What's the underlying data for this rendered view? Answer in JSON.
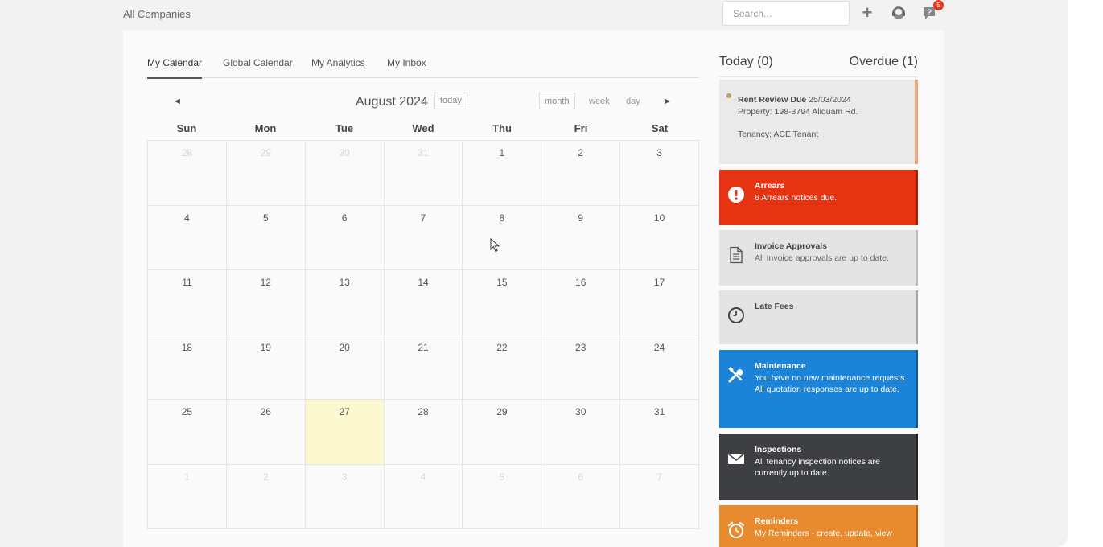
{
  "header": {
    "company": "All Companies",
    "search_placeholder": "Search...",
    "notification_count": "5"
  },
  "tabs": [
    {
      "label": "My Calendar",
      "active": true
    },
    {
      "label": "Global Calendar",
      "active": false
    },
    {
      "label": "My Analytics",
      "active": false
    },
    {
      "label": "My Inbox",
      "active": false
    }
  ],
  "calendar": {
    "prev_arrow": "◄",
    "next_arrow": "►",
    "month_title": "August 2024",
    "today_button": "today",
    "views": [
      "month",
      "week",
      "day"
    ],
    "days_of_week": [
      "Sun",
      "Mon",
      "Tue",
      "Wed",
      "Thu",
      "Fri",
      "Sat"
    ],
    "weeks": [
      [
        "28",
        "29",
        "30",
        "31",
        "1",
        "2",
        "3"
      ],
      [
        "4",
        "5",
        "6",
        "7",
        "8",
        "9",
        "10"
      ],
      [
        "11",
        "12",
        "13",
        "14",
        "15",
        "16",
        "17"
      ],
      [
        "18",
        "19",
        "20",
        "21",
        "22",
        "23",
        "24"
      ],
      [
        "25",
        "26",
        "27",
        "28",
        "29",
        "30",
        "31"
      ],
      [
        "1",
        "2",
        "3",
        "4",
        "5",
        "6",
        "7"
      ]
    ]
  },
  "summary": {
    "today": "Today (0)",
    "overdue": "Overdue (1)"
  },
  "rent_review": {
    "title": "Rent Review Due",
    "date": "25/03/2024",
    "property": "Property: 198-3794 Aliquam Rd.",
    "tenancy": "Tenancy: ACE Tenant"
  },
  "cards": {
    "arrears": {
      "title": "Arrears",
      "lines": [
        "6 Arrears notices due."
      ]
    },
    "invoice": {
      "title": "Invoice Approvals",
      "lines": [
        "All Invoice approvals are up to date."
      ]
    },
    "late_fees": {
      "title": "Late Fees",
      "lines": []
    },
    "maintenance": {
      "title": "Maintenance",
      "lines": [
        "You have no new maintenance requests.",
        "All quotation responses are up to date."
      ]
    },
    "inspections": {
      "title": "Inspections",
      "lines": [
        "All tenancy inspection notices are currently up to date."
      ]
    },
    "reminders": {
      "title": "Reminders",
      "lines": [
        "My Reminders - create, update, view"
      ]
    }
  },
  "colors": {
    "arrears": "#e63312",
    "maintenance": "#1b84d8",
    "inspections": "#3d3f42",
    "reminders": "#e88a2e",
    "today_highlight": "#fcf8d0"
  }
}
